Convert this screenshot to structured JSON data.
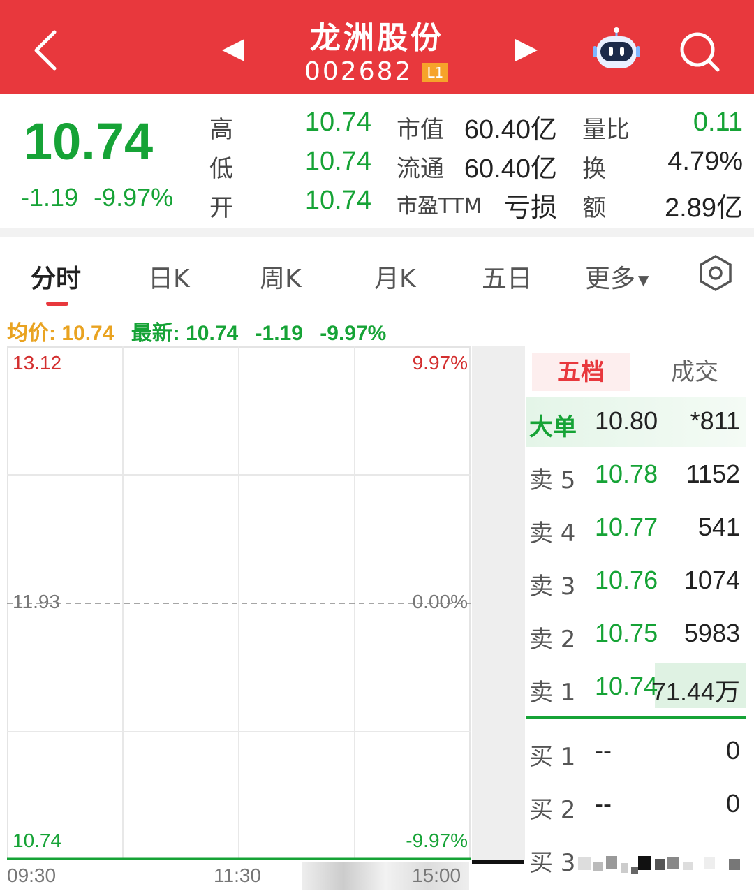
{
  "header": {
    "stock_name": "龙洲股份",
    "stock_code": "002682",
    "level": "L1"
  },
  "quote": {
    "price": "10.74",
    "change": "-1.19",
    "change_pct": "-9.97%",
    "high_label": "高",
    "high": "10.74",
    "low_label": "低",
    "low": "10.74",
    "open_label": "开",
    "open": "10.74",
    "mktcap_label": "市值",
    "mktcap": "60.40亿",
    "float_label": "流通",
    "float": "60.40亿",
    "pe_label": "市盈TTM",
    "pe": "亏损",
    "volratio_label": "量比",
    "volratio": "0.11",
    "turnover_label": "换",
    "turnover": "4.79%",
    "amount_label": "额",
    "amount": "2.89亿"
  },
  "tabs": [
    "分时",
    "日K",
    "周K",
    "月K",
    "五日",
    "更多"
  ],
  "info": {
    "avg_label": "均价:",
    "avg": "10.74",
    "latest_label": "最新:",
    "latest": "10.74",
    "latest_chg": "-1.19",
    "latest_pct": "-9.97%"
  },
  "chart": {
    "y_top": "13.12",
    "y_mid": "11.93",
    "y_bot": "10.74",
    "pct_top": "9.97%",
    "pct_mid": "0.00%",
    "pct_bot": "-9.97%",
    "times": [
      "09:30",
      "11:30",
      "15:00"
    ]
  },
  "orderbook": {
    "tab_active": "五档",
    "tab_other": "成交",
    "rows": [
      {
        "label": "大单",
        "price": "10.80",
        "vol": "*811"
      },
      {
        "label": "卖 5",
        "price": "10.78",
        "vol": "1152"
      },
      {
        "label": "卖 4",
        "price": "10.77",
        "vol": "541"
      },
      {
        "label": "卖 3",
        "price": "10.76",
        "vol": "1074"
      },
      {
        "label": "卖 2",
        "price": "10.75",
        "vol": "5983"
      },
      {
        "label": "卖 1",
        "price": "10.74",
        "vol": "71.44万"
      },
      {
        "label": "买 1",
        "price": "--",
        "vol": "0"
      },
      {
        "label": "买 2",
        "price": "--",
        "vol": "0"
      },
      {
        "label": "买 3",
        "price": "",
        "vol": ""
      }
    ]
  },
  "colors": {
    "header": "#e8383d",
    "down": "#16a336",
    "up": "#d32f2f",
    "avg": "#e9a321"
  }
}
